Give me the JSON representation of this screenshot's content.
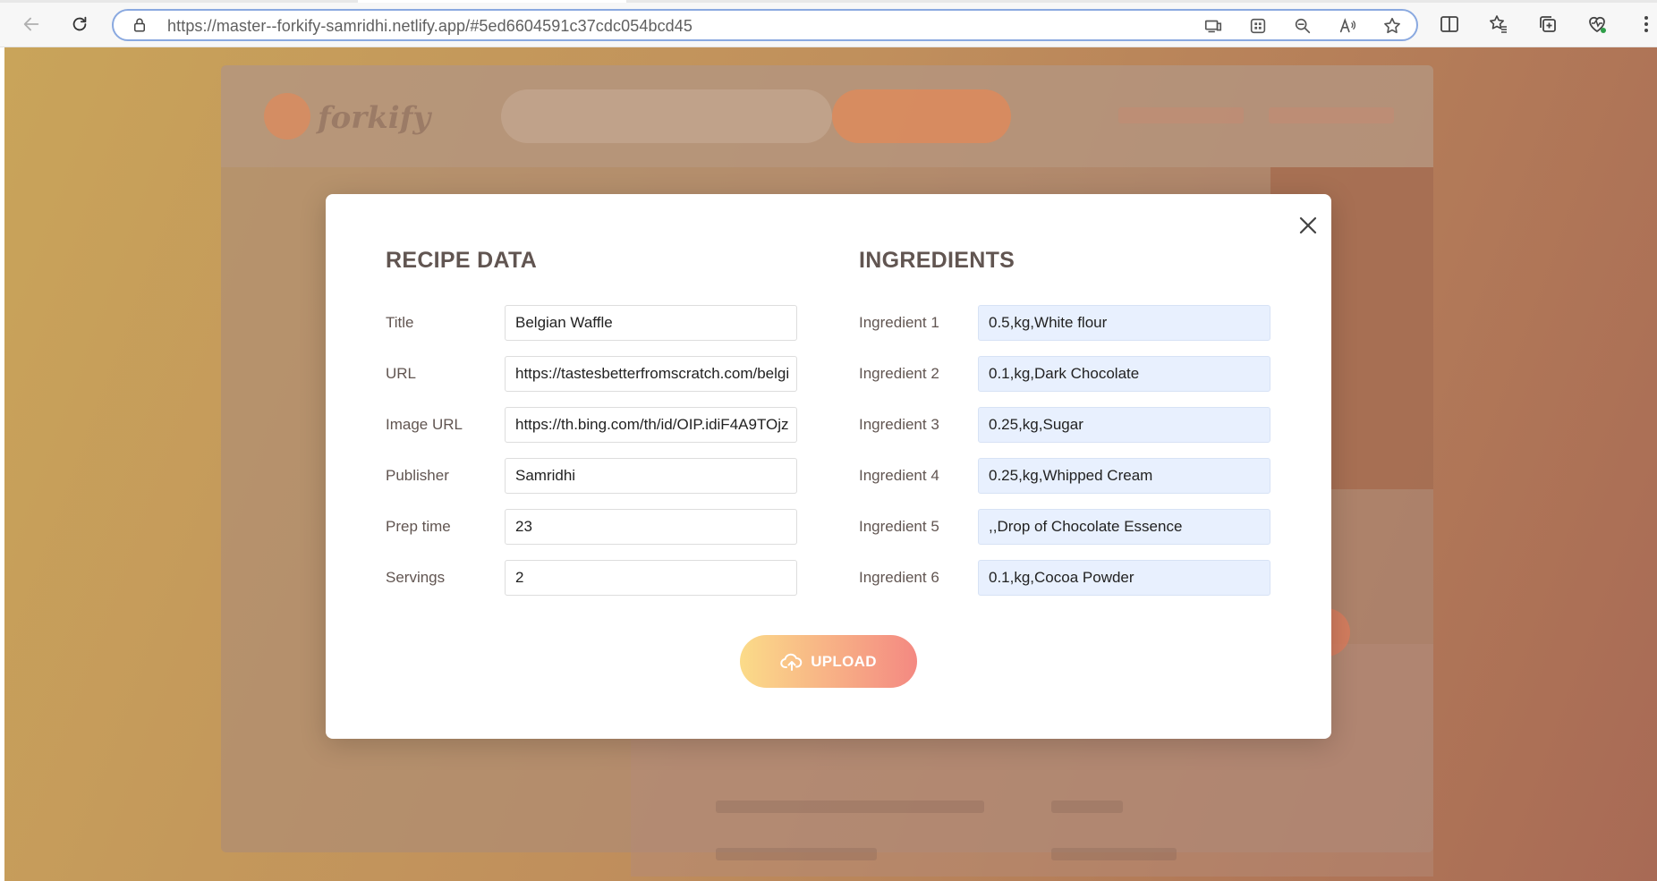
{
  "browser": {
    "url_host": "https://master--forkify-samridhi.netlify.app",
    "url_path": "/#5ed6604591c37cdc054bcd45"
  },
  "background_app": {
    "logo_text": "forkify"
  },
  "modal": {
    "recipe_heading": "RECIPE DATA",
    "ingredients_heading": "INGREDIENTS",
    "recipe_fields": [
      {
        "label": "Title",
        "value": "Belgian Waffle"
      },
      {
        "label": "URL",
        "value": "https://tastesbetterfromscratch.com/belgi"
      },
      {
        "label": "Image URL",
        "value": "https://th.bing.com/th/id/OIP.idiF4A9TOjz"
      },
      {
        "label": "Publisher",
        "value": "Samridhi"
      },
      {
        "label": "Prep time",
        "value": "23"
      },
      {
        "label": "Servings",
        "value": "2"
      }
    ],
    "ingredient_fields": [
      {
        "label": "Ingredient 1",
        "value": "0.5,kg,White flour"
      },
      {
        "label": "Ingredient 2",
        "value": "0.1,kg,Dark Chocolate"
      },
      {
        "label": "Ingredient 3",
        "value": "0.25,kg,Sugar"
      },
      {
        "label": "Ingredient 4",
        "value": "0.25,kg,Whipped Cream"
      },
      {
        "label": "Ingredient 5",
        "value": ",,Drop of Chocolate Essence"
      },
      {
        "label": "Ingredient 6",
        "value": "0.1,kg,Cocoa Powder"
      }
    ],
    "upload_label": "UPLOAD"
  },
  "colors": {
    "heading": "#615551",
    "upload_gradient_start": "#fbdb89",
    "upload_gradient_end": "#f48982",
    "autofill_bg": "#e8f0fe"
  }
}
